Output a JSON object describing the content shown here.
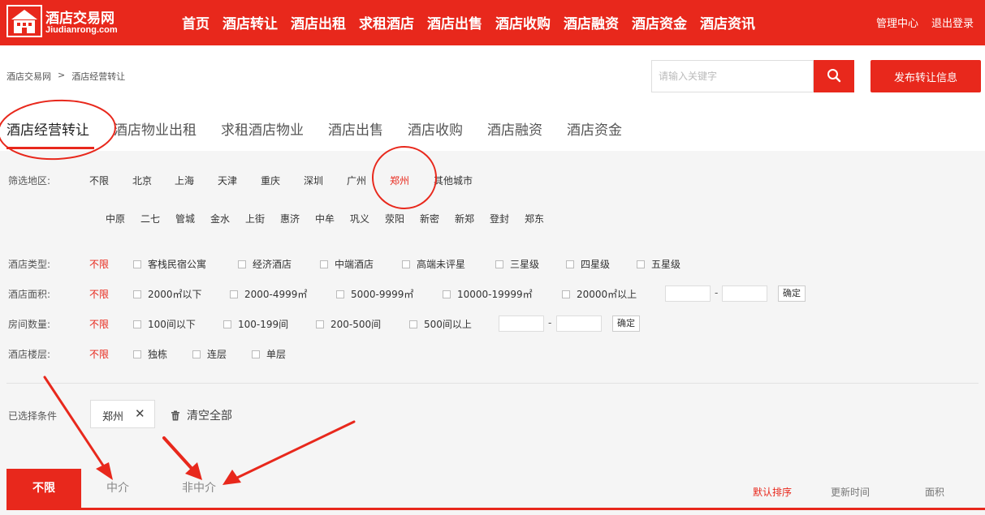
{
  "header": {
    "logo_name": "酒店交易网",
    "logo_domain": "Jiudianrong.com",
    "nav": [
      "首页",
      "酒店转让",
      "酒店出租",
      "求租酒店",
      "酒店出售",
      "酒店收购",
      "酒店融资",
      "酒店资金",
      "酒店资讯"
    ],
    "user_links": [
      "管理中心",
      "退出登录"
    ]
  },
  "breadcrumb": {
    "home": "酒店交易网",
    "sep": ">",
    "current": "酒店经营转让"
  },
  "search": {
    "placeholder": "请输入关键字",
    "publish_label": "发布转让信息"
  },
  "category_tabs": [
    "酒店经营转让",
    "酒店物业出租",
    "求租酒店物业",
    "酒店出售",
    "酒店收购",
    "酒店融资",
    "酒店资金"
  ],
  "filters": {
    "region": {
      "label": "筛选地区:",
      "options": [
        "不限",
        "北京",
        "上海",
        "天津",
        "重庆",
        "深圳",
        "广州",
        "郑州",
        "其他城市"
      ],
      "selected": "郑州",
      "sub_options": [
        "中原",
        "二七",
        "管城",
        "金水",
        "上街",
        "惠济",
        "中牟",
        "巩义",
        "荥阳",
        "新密",
        "新郑",
        "登封",
        "郑东"
      ]
    },
    "hotel_type": {
      "label": "酒店类型:",
      "any": "不限",
      "options": [
        "客栈民宿公寓",
        "经济酒店",
        "中端酒店",
        "高端未评星",
        "三星级",
        "四星级",
        "五星级"
      ]
    },
    "area": {
      "label": "酒店面积:",
      "any": "不限",
      "options": [
        "2000㎡以下",
        "2000-4999㎡",
        "5000-9999㎡",
        "10000-19999㎡",
        "20000㎡以上"
      ],
      "dash": "-",
      "confirm": "确定"
    },
    "rooms": {
      "label": "房间数量:",
      "any": "不限",
      "options": [
        "100间以下",
        "100-199间",
        "200-500间",
        "500间以上"
      ],
      "dash": "-",
      "confirm": "确定"
    },
    "floors": {
      "label": "酒店楼层:",
      "any": "不限",
      "options": [
        "独栋",
        "连层",
        "单层"
      ]
    }
  },
  "selected_conditions": {
    "label": "已选择条件",
    "tag": "郑州",
    "clear_all": "清空全部"
  },
  "result_tabs": [
    "不限",
    "中介",
    "非中介"
  ],
  "sort_options": [
    "默认排序",
    "更新时间",
    "面积"
  ],
  "colors": {
    "brand": "#e8281c",
    "panel": "#f5f5f5"
  },
  "icons": {
    "search": "search-icon",
    "close": "close-icon",
    "trash": "trash-icon"
  }
}
